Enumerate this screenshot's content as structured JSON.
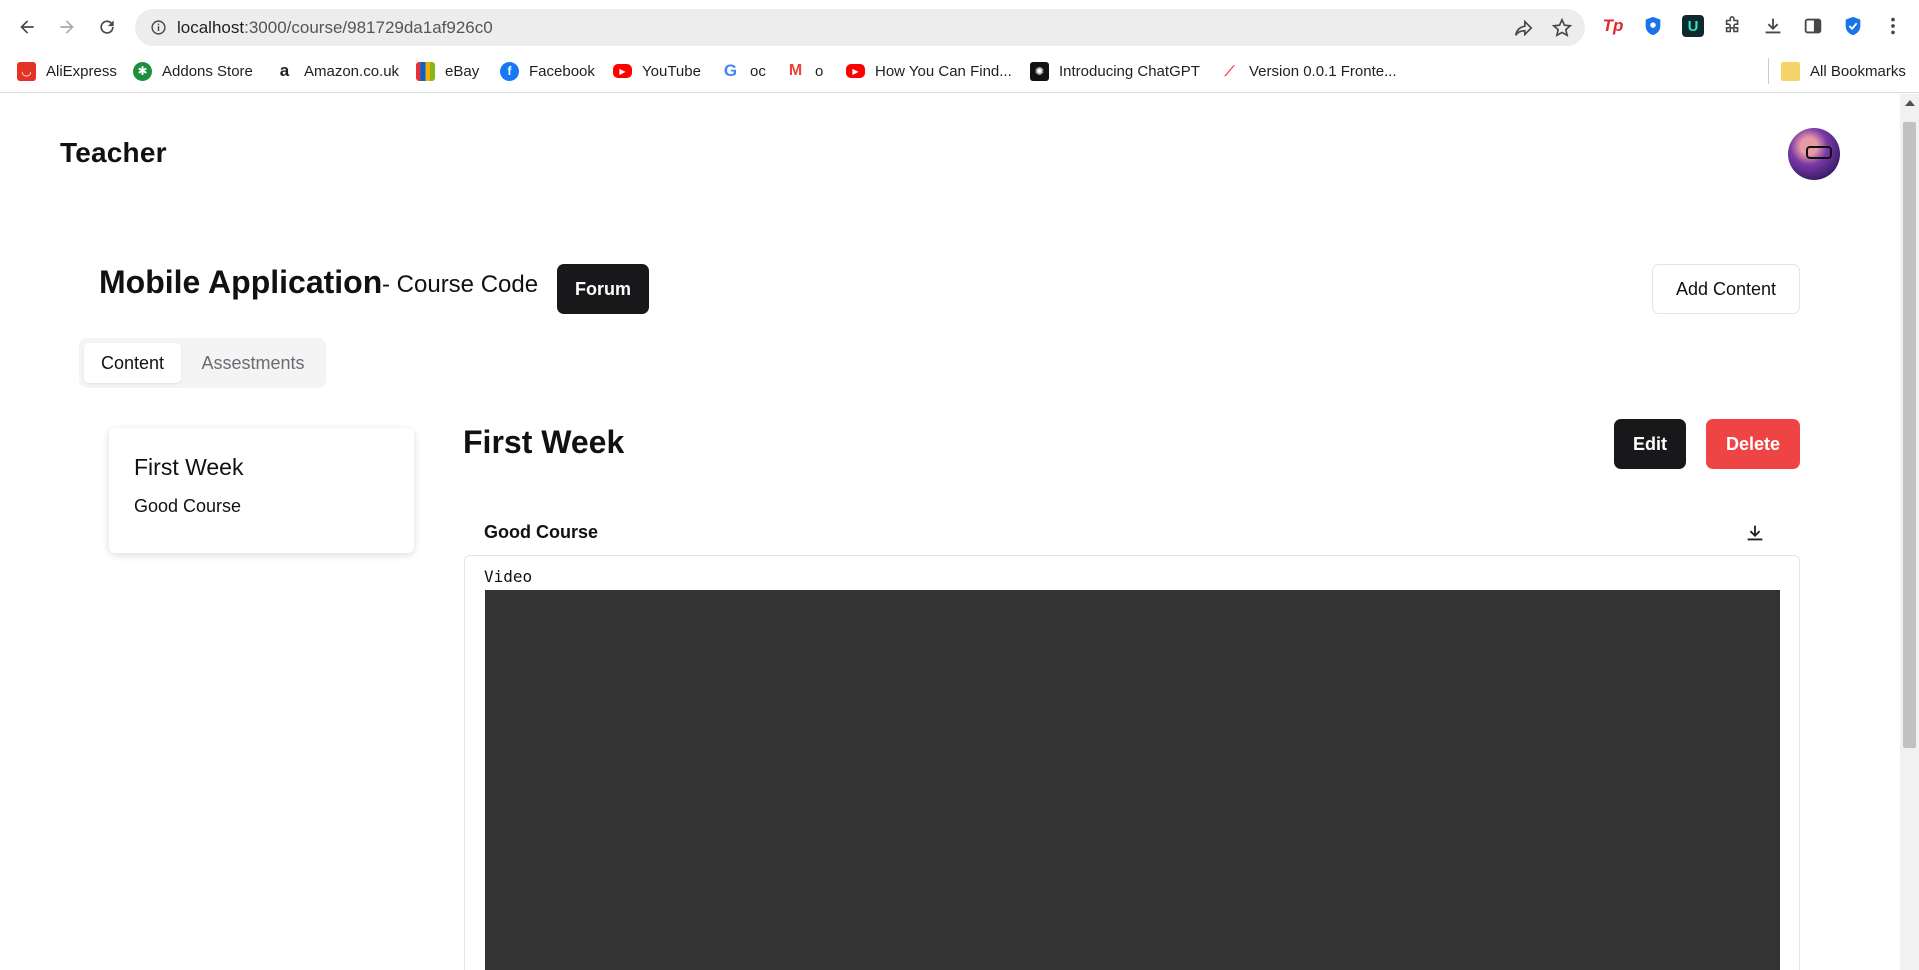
{
  "browser": {
    "url_host": "localhost",
    "url_path": ":3000/course/981729da1af926c0",
    "bookmarks": [
      {
        "label": "AliExpress",
        "icon": "aliexpress-icon",
        "color": "#e43225"
      },
      {
        "label": "Addons Store",
        "icon": "addons-store-icon",
        "color": "#1e8e3e"
      },
      {
        "label": "Amazon.co.uk",
        "icon": "amazon-icon",
        "color": "#222222"
      },
      {
        "label": "eBay",
        "icon": "ebay-icon",
        "color": "#e53238"
      },
      {
        "label": "Facebook",
        "icon": "facebook-icon",
        "color": "#1877f2"
      },
      {
        "label": "YouTube",
        "icon": "youtube-icon",
        "color": "#ff0000"
      },
      {
        "label": "oc",
        "icon": "google-icon",
        "color": "#4285f4"
      },
      {
        "label": "o",
        "icon": "gmail-icon",
        "color": "#ea4335"
      },
      {
        "label": "How You Can Find...",
        "icon": "youtube-icon",
        "color": "#ff0000"
      },
      {
        "label": "Introducing ChatGPT",
        "icon": "chatgpt-icon",
        "color": "#111111"
      },
      {
        "label": "Version 0.0.1 Fronte...",
        "icon": "monday-icon",
        "color": "#ff3d57"
      }
    ],
    "all_bookmarks": "All Bookmarks"
  },
  "header": {
    "brand": "Teacher"
  },
  "course": {
    "title": "Mobile Application",
    "code": "- Course Code",
    "forum_label": "Forum",
    "add_content_label": "Add Content"
  },
  "tabs": [
    {
      "label": "Content",
      "active": true
    },
    {
      "label": "Assestments",
      "active": false
    }
  ],
  "sidebar": {
    "week_title": "First Week",
    "week_subtitle": "Good Course"
  },
  "main": {
    "section_title": "First Week",
    "edit_label": "Edit",
    "delete_label": "Delete",
    "item_title": "Good Course",
    "media_label": "Video"
  },
  "colors": {
    "primary": "#18181b",
    "danger": "#ef4444",
    "video_bg": "#333333"
  }
}
